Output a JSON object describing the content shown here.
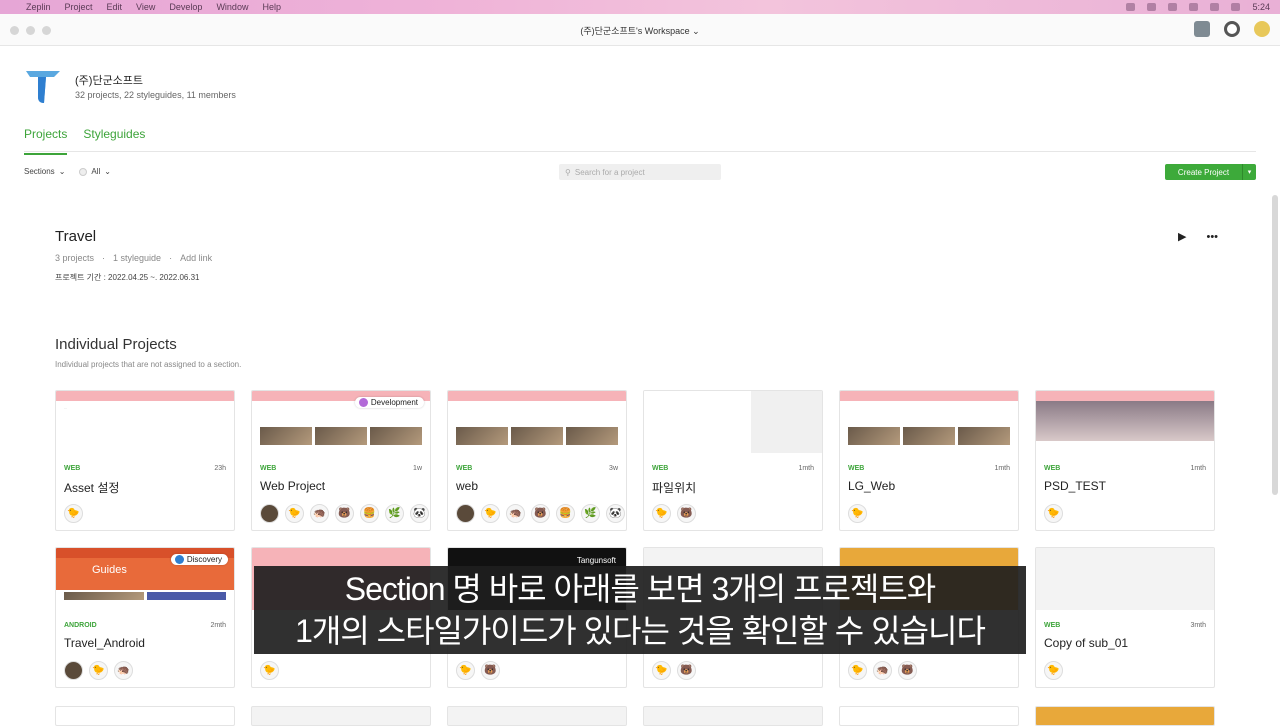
{
  "menubar": {
    "items": [
      "Zeplin",
      "Project",
      "Edit",
      "View",
      "Develop",
      "Window",
      "Help"
    ],
    "clock": "5:24"
  },
  "window": {
    "title": "(주)단군소프트's Workspace ⌄"
  },
  "workspace": {
    "name": "(주)단군소프트",
    "meta": "32 projects, 22 styleguides, 11 members"
  },
  "tabs": [
    "Projects",
    "Styleguides"
  ],
  "filters": {
    "sections": "Sections",
    "all": "All"
  },
  "search": {
    "placeholder": "Search for a project"
  },
  "create_button": "Create Project",
  "section": {
    "title": "Travel",
    "projects": "3 projects",
    "styleguide": "1 styleguide",
    "add_link": "Add link",
    "note": "프로젝트 기간 : 2022.04.25 ~. 2022.06.31"
  },
  "individual": {
    "title": "Individual Projects",
    "subtitle": "Individual projects that are not assigned to a section."
  },
  "cards": [
    {
      "type": "WEB",
      "time": "23h",
      "name": "Asset 설정"
    },
    {
      "type": "WEB",
      "time": "1w",
      "name": "Web Project",
      "badge": "Development"
    },
    {
      "type": "WEB",
      "time": "3w",
      "name": "web"
    },
    {
      "type": "WEB",
      "time": "1mth",
      "name": "파일위치"
    },
    {
      "type": "WEB",
      "time": "1mth",
      "name": "LG_Web"
    },
    {
      "type": "WEB",
      "time": "1mth",
      "name": "PSD_TEST"
    },
    {
      "type": "ANDROID",
      "time": "2mth",
      "name": "Travel_Android",
      "badge": "Discovery",
      "thumb_label": "Guides"
    },
    {
      "type": "",
      "time": "",
      "name": ""
    },
    {
      "type": "",
      "time": "",
      "name": "",
      "thumb_label": "Tangunsoft"
    },
    {
      "type": "",
      "time": "",
      "name": ""
    },
    {
      "type": "",
      "time": "",
      "name": ""
    },
    {
      "type": "WEB",
      "time": "3mth",
      "name": "Copy of sub_01"
    }
  ],
  "subtitle": {
    "line1": "Section 명 바로 아래를 보면 3개의 프로젝트와",
    "line2": "1개의 스타일가이드가 있다는 것을 확인할 수 있습니다"
  }
}
